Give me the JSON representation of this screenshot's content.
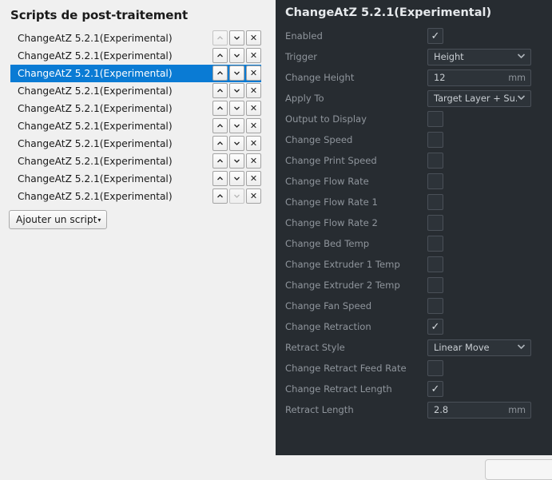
{
  "left_panel": {
    "title": "Scripts de post-traitement",
    "scripts": [
      {
        "label": "ChangeAtZ 5.2.1(Experimental)",
        "selected": false,
        "up_enabled": false,
        "down_enabled": true
      },
      {
        "label": "ChangeAtZ 5.2.1(Experimental)",
        "selected": false,
        "up_enabled": true,
        "down_enabled": true
      },
      {
        "label": "ChangeAtZ 5.2.1(Experimental)",
        "selected": true,
        "up_enabled": true,
        "down_enabled": true
      },
      {
        "label": "ChangeAtZ 5.2.1(Experimental)",
        "selected": false,
        "up_enabled": true,
        "down_enabled": true
      },
      {
        "label": "ChangeAtZ 5.2.1(Experimental)",
        "selected": false,
        "up_enabled": true,
        "down_enabled": true
      },
      {
        "label": "ChangeAtZ 5.2.1(Experimental)",
        "selected": false,
        "up_enabled": true,
        "down_enabled": true
      },
      {
        "label": "ChangeAtZ 5.2.1(Experimental)",
        "selected": false,
        "up_enabled": true,
        "down_enabled": true
      },
      {
        "label": "ChangeAtZ 5.2.1(Experimental)",
        "selected": false,
        "up_enabled": true,
        "down_enabled": true
      },
      {
        "label": "ChangeAtZ 5.2.1(Experimental)",
        "selected": false,
        "up_enabled": true,
        "down_enabled": true
      },
      {
        "label": "ChangeAtZ 5.2.1(Experimental)",
        "selected": false,
        "up_enabled": true,
        "down_enabled": false
      }
    ],
    "row_buttons": {
      "move_up": "move-up",
      "move_down": "move-down",
      "remove": "✕"
    },
    "add_script_button": {
      "label": "Ajouter un script",
      "caret": "▾"
    },
    "selection_color": "#0a7bd4"
  },
  "right_panel": {
    "title": "ChangeAtZ 5.2.1(Experimental)",
    "background_color": "#272c31",
    "label_color": "#8f959c",
    "settings": [
      {
        "label": "Enabled",
        "type": "checkbox",
        "checked": true
      },
      {
        "label": "Trigger",
        "type": "dropdown",
        "value": "Height"
      },
      {
        "label": "Change Height",
        "type": "number",
        "value": "12",
        "unit": "mm"
      },
      {
        "label": "Apply To",
        "type": "dropdown",
        "value": "Target Layer + Su..."
      },
      {
        "label": "Output to Display",
        "type": "checkbox",
        "checked": false
      },
      {
        "label": "Change Speed",
        "type": "checkbox",
        "checked": false
      },
      {
        "label": "Change Print Speed",
        "type": "checkbox",
        "checked": false
      },
      {
        "label": "Change Flow Rate",
        "type": "checkbox",
        "checked": false
      },
      {
        "label": "Change Flow Rate 1",
        "type": "checkbox",
        "checked": false
      },
      {
        "label": "Change Flow Rate 2",
        "type": "checkbox",
        "checked": false
      },
      {
        "label": "Change Bed Temp",
        "type": "checkbox",
        "checked": false
      },
      {
        "label": "Change Extruder 1 Temp",
        "type": "checkbox",
        "checked": false
      },
      {
        "label": "Change Extruder 2 Temp",
        "type": "checkbox",
        "checked": false
      },
      {
        "label": "Change Fan Speed",
        "type": "checkbox",
        "checked": false
      },
      {
        "label": "Change Retraction",
        "type": "checkbox",
        "checked": true
      },
      {
        "label": "Retract Style",
        "type": "dropdown",
        "value": "Linear Move"
      },
      {
        "label": "Change Retract Feed Rate",
        "type": "checkbox",
        "checked": false
      },
      {
        "label": "Change Retract Length",
        "type": "checkbox",
        "checked": true
      },
      {
        "label": "Retract Length",
        "type": "number",
        "value": "2.8",
        "unit": "mm"
      }
    ],
    "checkbox_tick": "✓"
  }
}
